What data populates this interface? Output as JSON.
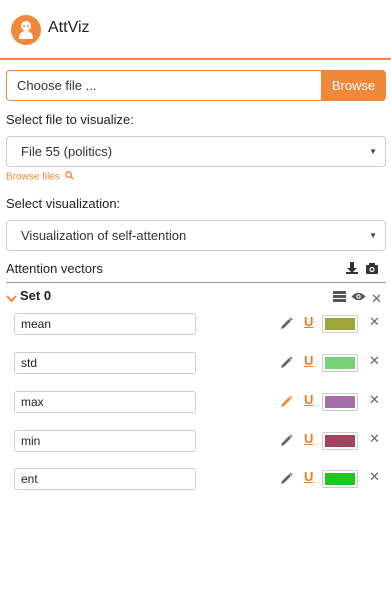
{
  "app": {
    "title": "AttViz"
  },
  "file_upload": {
    "placeholder": "Choose file ...",
    "browse_label": "Browse"
  },
  "file_select": {
    "label": "Select file to visualize:",
    "value": "File 55 (politics)"
  },
  "browse_files": {
    "label": "Browse files"
  },
  "viz_select": {
    "label": "Select visualization:",
    "value": "Visualization of self-attention"
  },
  "attention": {
    "title": "Attention vectors"
  },
  "set": {
    "name": "Set 0"
  },
  "vectors": [
    {
      "name": "mean",
      "color": "#a0a53c",
      "pencil_color": "#666666"
    },
    {
      "name": "std",
      "color": "#79d177",
      "pencil_color": "#666666"
    },
    {
      "name": "max",
      "color": "#a36fa8",
      "pencil_color": "#f0873a"
    },
    {
      "name": "min",
      "color": "#a3425f",
      "pencil_color": "#666666"
    },
    {
      "name": "ent",
      "color": "#1ec61e",
      "pencil_color": "#666666"
    }
  ],
  "colors": {
    "accent": "#f0873a"
  }
}
